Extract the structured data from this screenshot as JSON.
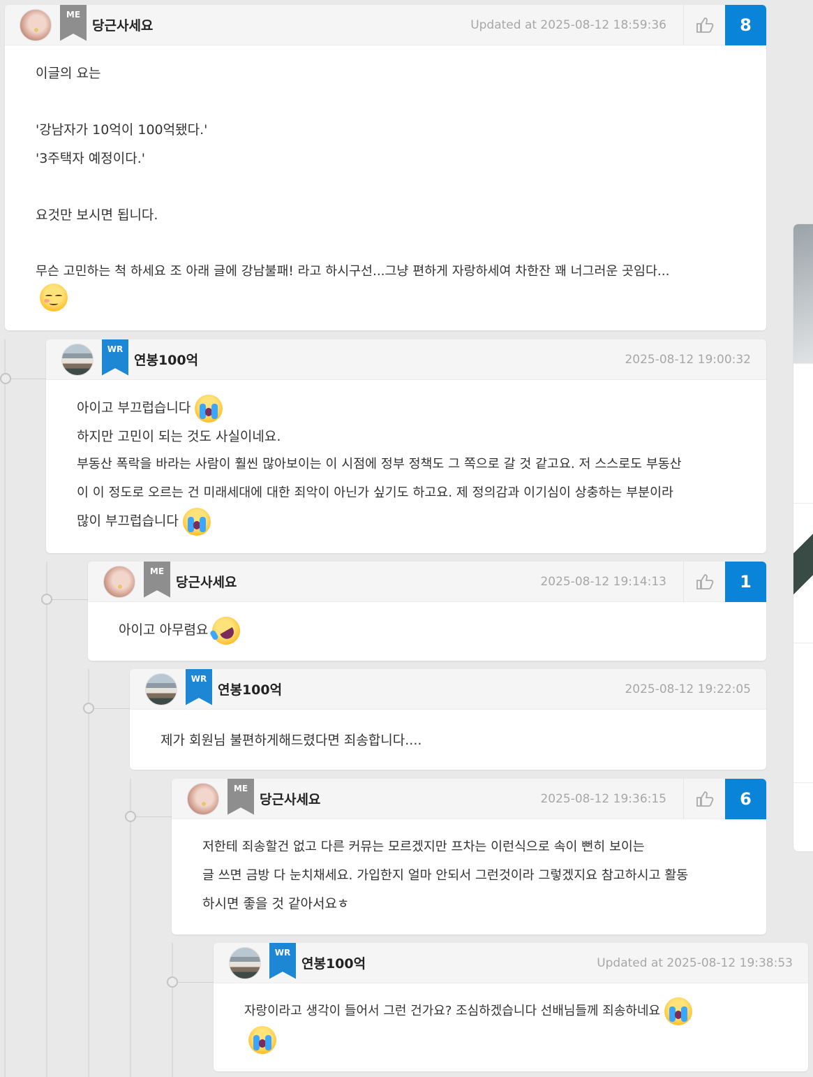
{
  "comments": [
    {
      "author": "당근사세요",
      "badge": "ME",
      "time": "Updated at 2025-08-12 18:59:36",
      "likes": "8",
      "lines": [
        "이글의 요는",
        "",
        "'강남자가 10억이 100억됐다.'",
        "'3주택자 예정이다.'",
        "",
        "요것만 보시면 됩니다.",
        "",
        "무슨 고민하는 척 하세요 조 아래 글에 강남불패! 라고 하시구선...그냥 편하게 자랑하세여 차한잔 꽤 너그러운 곳임다..."
      ]
    },
    {
      "author": "연봉100억",
      "badge": "WR",
      "time": "2025-08-12 19:00:32",
      "lines": [
        "아이고 부끄럽습니다",
        "하지만 고민이 되는 것도 사실이네요.",
        "부동산 폭락을 바라는 사람이 훨씬 많아보이는 이 시점에 정부 정책도 그 쪽으로 갈 것 같고요. 저 스스로도 부동산",
        "이 이 정도로 오르는 건 미래세대에 대한 죄악이 아닌가 싶기도 하고요. 제 정의감과 이기심이 상충하는 부분이라",
        "많이 부끄럽습니다"
      ]
    },
    {
      "author": "당근사세요",
      "badge": "ME",
      "time": "2025-08-12 19:14:13",
      "likes": "1",
      "lines": [
        "아이고 아무렴요"
      ]
    },
    {
      "author": "연봉100억",
      "badge": "WR",
      "time": "2025-08-12 19:22:05",
      "lines": [
        "제가 회원님 불편하게해드렸다면 죄송합니다...."
      ]
    },
    {
      "author": "당근사세요",
      "badge": "ME",
      "time": "2025-08-12 19:36:15",
      "likes": "6",
      "lines": [
        "저한테 죄송할건 없고 다른 커뮤는 모르겠지만 프차는 이런식으로 속이 뻔히 보이는",
        "글 쓰면 금방 다 눈치채세요. 가입한지 얼마 안되서 그런것이라 그렇겠지요 참고하시고 활동",
        "하시면 좋을 것 같아서요ㅎ"
      ]
    },
    {
      "author": "연봉100억",
      "badge": "WR",
      "time": "Updated at 2025-08-12 19:38:53",
      "lines": [
        "자랑이라고  생각이  들어서  그런  건가요?  조심하겠습니다  선배님들께  죄송하네요"
      ]
    }
  ],
  "icons": {
    "like": "thumbs-up-icon",
    "emoji_relieved": "relieved-face-emoji",
    "emoji_cry": "loudly-crying-face-emoji",
    "emoji_rofl": "rolling-on-floor-laughing-emoji"
  },
  "colors": {
    "accent": "#0a84d8",
    "badge_me": "#8e8e8e",
    "badge_wr": "#1d87d6",
    "background": "#e9e9e9"
  }
}
